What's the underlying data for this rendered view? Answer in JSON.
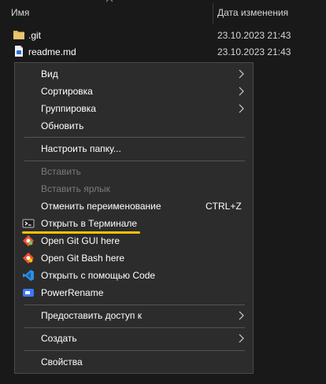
{
  "header": {
    "col_name": "Имя",
    "col_date": "Дата изменения"
  },
  "files": [
    {
      "name": ".git",
      "date": "23.10.2023 21:43",
      "icon": "folder-icon"
    },
    {
      "name": "readme.md",
      "date": "23.10.2023 21:43",
      "icon": "markdown-file-icon"
    }
  ],
  "menu": {
    "view": "Вид",
    "sort": "Сортировка",
    "group": "Группировка",
    "refresh": "Обновить",
    "customize": "Настроить папку...",
    "paste": "Вставить",
    "paste_shortcut": "Вставить ярлык",
    "undo_rename": "Отменить переименование",
    "undo_shortcut": "CTRL+Z",
    "open_terminal": "Открыть в Терминале",
    "git_gui": "Open Git GUI here",
    "git_bash": "Open Git Bash here",
    "open_code": "Открыть с помощью Code",
    "powerrename": "PowerRename",
    "share": "Предоставить доступ к",
    "new": "Создать",
    "properties": "Свойства"
  },
  "colors": {
    "highlight": "#f5c400",
    "folder": "#dcb05a",
    "vscode": "#2b8fe3",
    "powerrename": "#3a78ff"
  }
}
